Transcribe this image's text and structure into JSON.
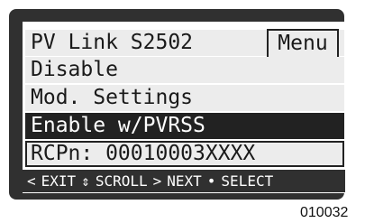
{
  "header": {
    "title": "PV Link S2502",
    "menu_label": "Menu"
  },
  "menu": {
    "items": [
      {
        "label": "Disable",
        "selected": false
      },
      {
        "label": "Mod. Settings",
        "selected": false
      },
      {
        "label": "Enable w/PVRSS",
        "selected": true
      },
      {
        "label": "RCPn: 00010003XXXX",
        "selected": false
      }
    ]
  },
  "status_bar": {
    "exit_icon": "chevron-left-icon",
    "exit_label": "EXIT",
    "scroll_icon": "up-down-arrow-icon",
    "scroll_label": "SCROLL",
    "next_icon": "chevron-right-icon",
    "next_label": "NEXT",
    "select_icon": "bullet-icon",
    "select_label": "SELECT"
  },
  "figure_id": "010032",
  "colors": {
    "bezel": "#303030",
    "row_background": "#ececec",
    "selected_background": "#222222",
    "selected_text": "#ffffff"
  }
}
